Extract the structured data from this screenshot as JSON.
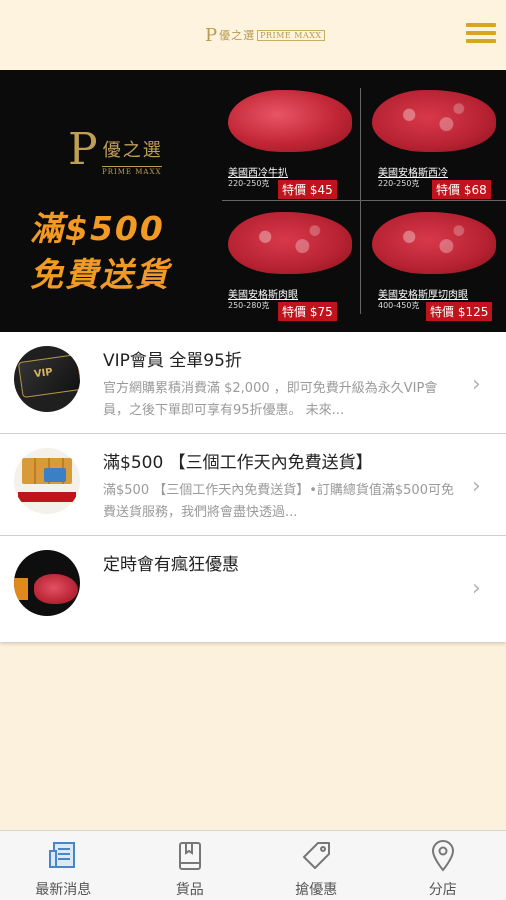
{
  "header": {
    "logo_mark": "P",
    "logo_cn": "優之選",
    "logo_en": "PRIME MAXX"
  },
  "banner": {
    "brand_mark": "P",
    "brand_cn": "優之選",
    "brand_en": "PRIME MAXX",
    "promo_line1": "滿$500",
    "promo_line2": "免費送貨",
    "products": [
      {
        "name": "美國西冷牛扒",
        "weight": "220-250克",
        "price": "特價 $45"
      },
      {
        "name": "美國安格斯西冷",
        "weight": "220-250克",
        "price": "特價 $68"
      },
      {
        "name": "美國安格斯肉眼",
        "weight": "250-280克",
        "price": "特價 $75"
      },
      {
        "name": "美國安格斯厚切肉眼",
        "weight": "400-450克",
        "price": "特價 $125"
      }
    ]
  },
  "news": [
    {
      "title": "VIP會員 全單95折",
      "desc": "官方網購累積消費滿 $2,000 ，即可免費升級為永久VIP會員，之後下單即可享有95折優惠。 未來...",
      "avatar_text": "VIP"
    },
    {
      "title": "滿$500 【三個工作天內免費送貨】",
      "desc": "滿$500 【三個工作天內免費送貨】•訂購總貨值滿$500可免費送貨服務，我們將會盡快透過...",
      "avatar_text": ""
    },
    {
      "title": "定時會有瘋狂優惠",
      "desc": "",
      "avatar_text": ""
    }
  ],
  "tabs": [
    {
      "label": "最新消息",
      "icon": "news-icon"
    },
    {
      "label": "貨品",
      "icon": "book-icon"
    },
    {
      "label": "搶優惠",
      "icon": "tag-icon"
    },
    {
      "label": "分店",
      "icon": "location-pin-icon"
    }
  ],
  "colors": {
    "accent": "#d9a521",
    "active_tab": "#4a86c5",
    "price_red": "#c0141c",
    "promo_orange": "#f39a24"
  }
}
